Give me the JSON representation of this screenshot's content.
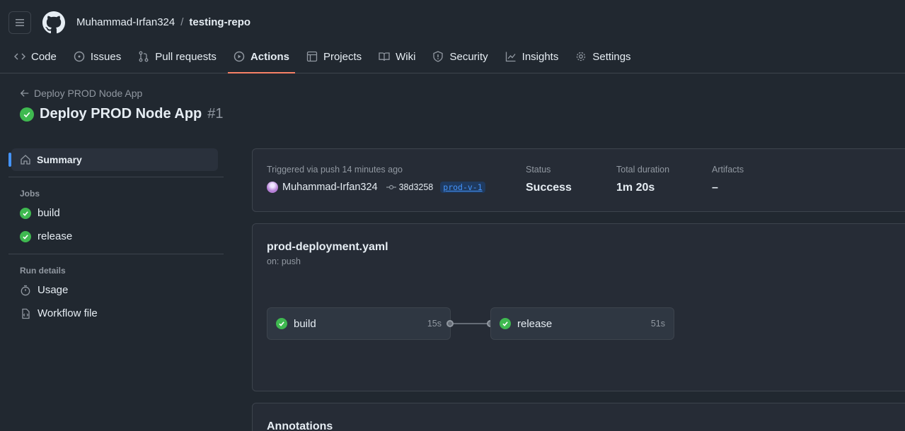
{
  "header": {
    "owner": "Muhammad-Irfan324",
    "separator": "/",
    "repo": "testing-repo"
  },
  "nav": {
    "items": [
      {
        "label": "Code",
        "icon": "code-icon"
      },
      {
        "label": "Issues",
        "icon": "issue-icon"
      },
      {
        "label": "Pull requests",
        "icon": "pull-request-icon"
      },
      {
        "label": "Actions",
        "icon": "play-icon",
        "active": true
      },
      {
        "label": "Projects",
        "icon": "table-icon"
      },
      {
        "label": "Wiki",
        "icon": "book-icon"
      },
      {
        "label": "Security",
        "icon": "shield-icon"
      },
      {
        "label": "Insights",
        "icon": "graph-icon"
      },
      {
        "label": "Settings",
        "icon": "gear-icon"
      }
    ]
  },
  "run": {
    "back_label": "Deploy PROD Node App",
    "title": "Deploy PROD Node App",
    "number": "#1"
  },
  "sidebar": {
    "summary": "Summary",
    "jobs_heading": "Jobs",
    "jobs": [
      {
        "label": "build",
        "status": "success"
      },
      {
        "label": "release",
        "status": "success"
      }
    ],
    "details_heading": "Run details",
    "usage": "Usage",
    "workflow_file": "Workflow file"
  },
  "summary": {
    "trigger": "Triggered via push 14 minutes ago",
    "actor": "Muhammad-Irfan324",
    "commit": "38d3258",
    "tag": "prod-v-1",
    "status_label": "Status",
    "status_value": "Success",
    "duration_label": "Total duration",
    "duration_value": "1m 20s",
    "artifacts_label": "Artifacts",
    "artifacts_value": "–"
  },
  "graph": {
    "file": "prod-deployment.yaml",
    "on": "on: push",
    "jobs": [
      {
        "name": "build",
        "duration": "15s"
      },
      {
        "name": "release",
        "duration": "51s"
      }
    ]
  },
  "annotations": {
    "title": "Annotations"
  },
  "colors": {
    "success": "#3fb950",
    "accent": "#4493f8",
    "active_tab": "#f78166"
  }
}
